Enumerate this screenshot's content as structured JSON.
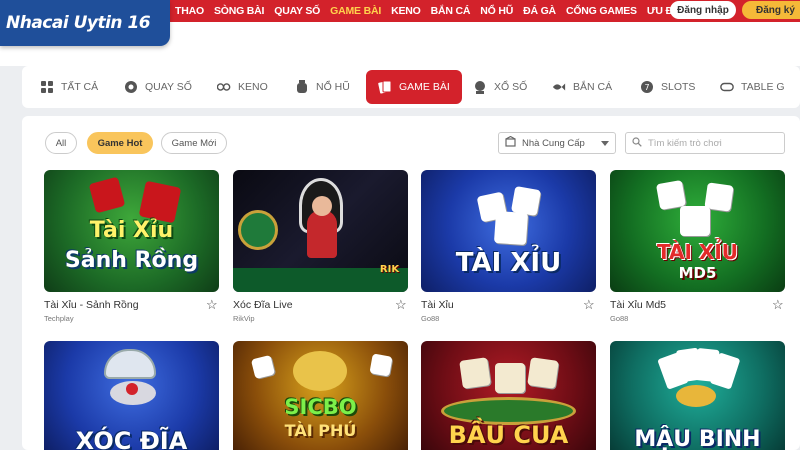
{
  "logo": {
    "text": "Nhacai Uytin 16"
  },
  "topnav": {
    "items": [
      {
        "label": "THAO",
        "active": false
      },
      {
        "label": "SÒNG BÀI",
        "active": false
      },
      {
        "label": "QUAY SỐ",
        "active": false
      },
      {
        "label": "GAME BÀI",
        "active": true
      },
      {
        "label": "KENO",
        "active": false
      },
      {
        "label": "BẮN CÁ",
        "active": false
      },
      {
        "label": "NỔ HŨ",
        "active": false
      },
      {
        "label": "ĐÁ GÀ",
        "active": false
      },
      {
        "label": "CỔNG GAMES",
        "active": false
      },
      {
        "label": "ƯU ĐÃI",
        "active": false
      }
    ],
    "login_label": "Đăng nhập",
    "register_label": "Đăng ký",
    "bar_color": "#d3222b"
  },
  "categories": [
    {
      "label": "TẤT CẢ",
      "icon": "grid-icon"
    },
    {
      "label": "QUAY SỐ",
      "icon": "lottery-ball-icon"
    },
    {
      "label": "KENO",
      "icon": "keno-balls-icon"
    },
    {
      "label": "NỔ HŨ",
      "icon": "jar-icon"
    },
    {
      "label": "GAME BÀI",
      "icon": "cards-icon",
      "active": true
    },
    {
      "label": "XỔ SỐ",
      "icon": "lottery-icon"
    },
    {
      "label": "BẮN CÁ",
      "icon": "fish-icon"
    },
    {
      "label": "SLOTS",
      "icon": "slot-icon"
    },
    {
      "label": "TABLE G",
      "icon": "table-icon"
    }
  ],
  "filters": {
    "all_label": "All",
    "hot_label": "Game Hot",
    "new_label": "Game Mới",
    "provider_label": "Nhà Cung Cấp",
    "search_placeholder": "Tìm kiếm trò chơi"
  },
  "games": [
    {
      "name": "Tài Xỉu - Sảnh Rồng",
      "provider": "Techplay",
      "art": "Tài Xỉu\nSảnh Rồng"
    },
    {
      "name": "Xóc Đĩa Live",
      "provider": "RikVip",
      "art": "RIK"
    },
    {
      "name": "Tài Xỉu",
      "provider": "Go88",
      "art": "TÀI XỈU"
    },
    {
      "name": "Tài Xỉu Md5",
      "provider": "Go88",
      "art": "TÀI XỈU\nMD5"
    },
    {
      "name": "",
      "provider": "",
      "art": "XÓC ĐĨA"
    },
    {
      "name": "",
      "provider": "",
      "art": "SICBO\nTÀI PHÚ"
    },
    {
      "name": "",
      "provider": "",
      "art": "BẦU CUA"
    },
    {
      "name": "",
      "provider": "",
      "art": "MẬU BINH"
    }
  ],
  "colors": {
    "accent": "#d3222b",
    "hot": "#f9c55c",
    "brand": "#1f4f9a"
  }
}
